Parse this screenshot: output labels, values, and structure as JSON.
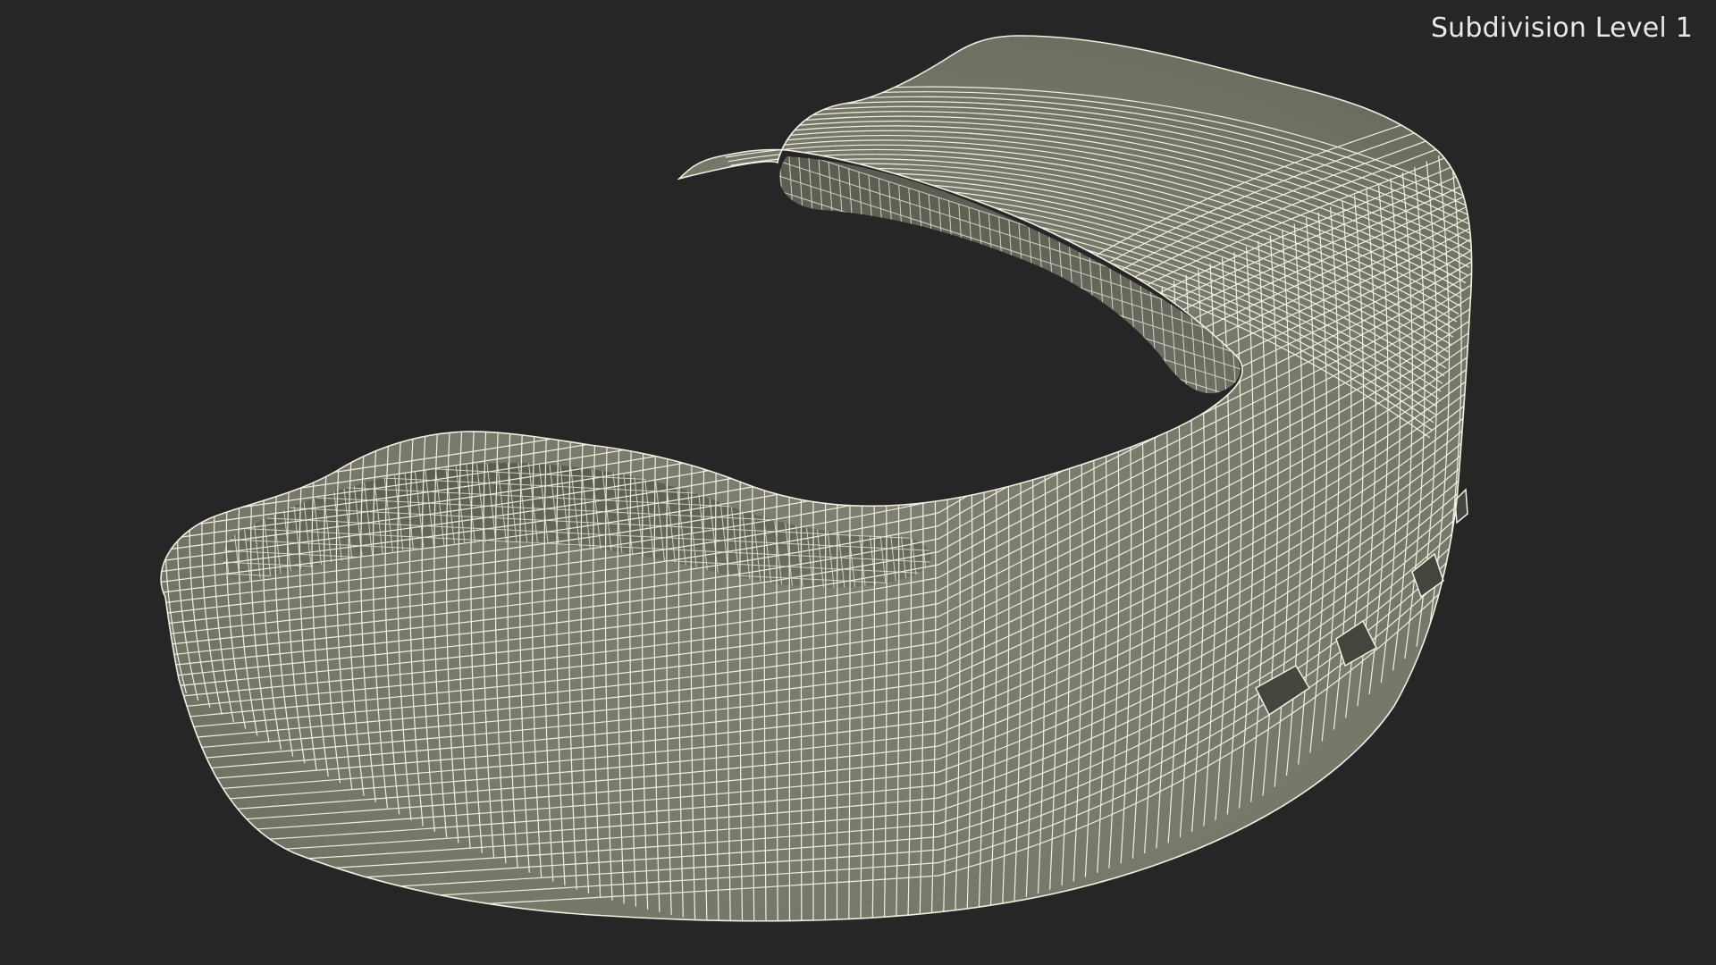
{
  "viewport": {
    "label": "Subdivision Level 1",
    "background_color": "#262626",
    "surface_color": "#7b7b6d",
    "wire_color": "#f4f2e6"
  },
  "model": {
    "object": "mouthguard-wireframe",
    "render_mode": "wireframe-on-shaded"
  }
}
